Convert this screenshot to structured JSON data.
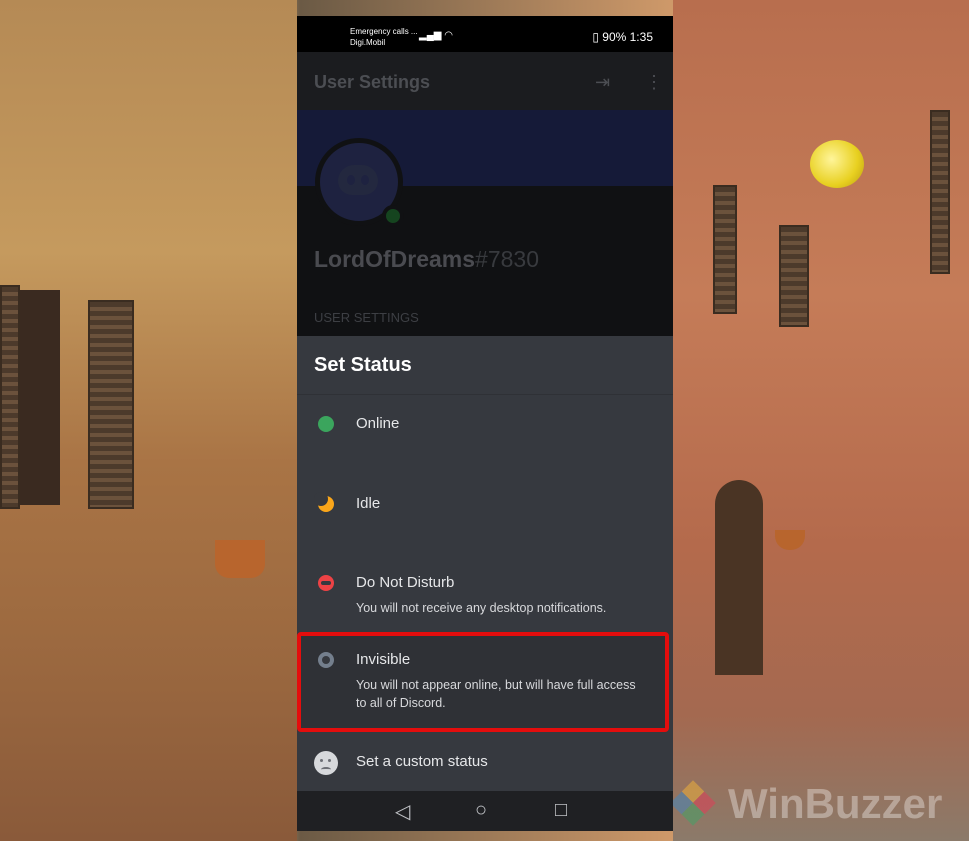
{
  "statusbar": {
    "carrier_line1": "Emergency calls ...",
    "carrier_line2": "Digi.Mobil",
    "right": "90%  1:35"
  },
  "header": {
    "title": "User Settings"
  },
  "profile": {
    "username": "LordOfDreams",
    "discriminator": "#7830",
    "section_label": "USER SETTINGS"
  },
  "sheet": {
    "title": "Set Status",
    "options": [
      {
        "label": "Online",
        "color": "#3ba55d"
      },
      {
        "label": "Idle",
        "color": "#faa61a"
      },
      {
        "label": "Do Not Disturb",
        "description": "You will not receive any desktop notifications.",
        "color": "#ed4245"
      },
      {
        "label": "Invisible",
        "description": "You will not appear online, but will have full access to all of Discord.",
        "color": "#747f8d"
      }
    ],
    "custom_status": "Set a custom status"
  },
  "highlight_color": "#e40d0d",
  "watermark": "WinBuzzer"
}
